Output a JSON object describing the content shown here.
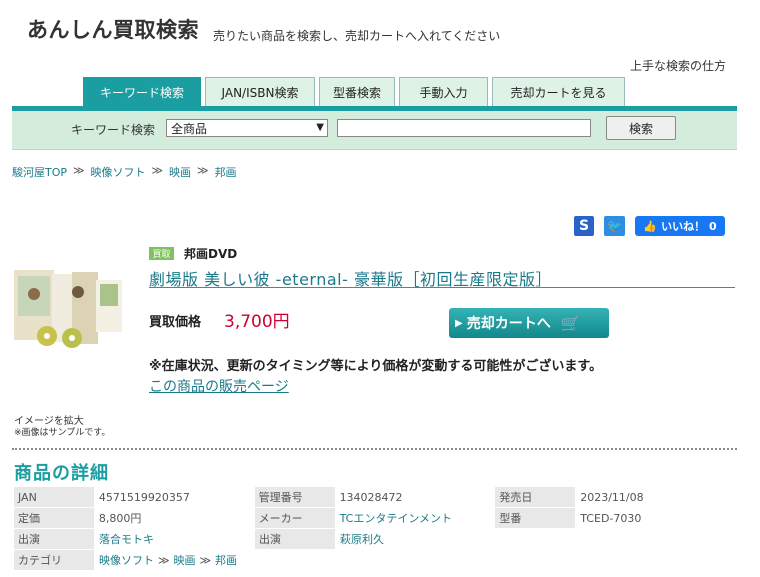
{
  "header": {
    "title": "あんしん買取検索",
    "subtitle": "売りたい商品を検索し、売却カートへ入れてください",
    "howto_link": "上手な検索の仕方"
  },
  "tabs": [
    {
      "label": "キーワード検索",
      "active": true
    },
    {
      "label": "JAN/ISBN検索",
      "active": false
    },
    {
      "label": "型番検索",
      "active": false
    },
    {
      "label": "手動入力",
      "active": false
    },
    {
      "label": "売却カートを見る",
      "active": false
    }
  ],
  "search": {
    "label": "キーワード検索",
    "category_selected": "全商品",
    "keyword_value": "",
    "button": "検索"
  },
  "breadcrumb": [
    "駿河屋TOP",
    "映像ソフト",
    "映画",
    "邦画"
  ],
  "breadcrumb_sep": "≫",
  "social": {
    "s_label": "S",
    "twitter_label": "🐦",
    "like_label": "いいね！ 0"
  },
  "product": {
    "badge": "買取",
    "genre": "邦画DVD",
    "title": "劇場版 美しい彼 -eternal- 豪華版［初回生産限定版］",
    "price_label": "買取価格",
    "price": "3,700円",
    "cart_button": "売却カートへ",
    "notice": "※在庫状況、更新のタイミング等により価格が変動する可能性がございます。",
    "sale_link": "この商品の販売ページ",
    "image_enlarge": "イメージを拡大",
    "image_note": "※画像はサンプルです。"
  },
  "details": {
    "heading": "商品の詳細",
    "rows": [
      [
        {
          "label": "JAN",
          "value": "4571519920357"
        },
        {
          "label": "管理番号",
          "value": "134028472"
        },
        {
          "label": "発売日",
          "value": "2023/11/08"
        }
      ],
      [
        {
          "label": "定価",
          "value": "8,800円"
        },
        {
          "label": "メーカー",
          "value": "TCエンタテインメント"
        },
        {
          "label": "型番",
          "value": "TCED-7030"
        }
      ],
      [
        {
          "label": "出演",
          "value": "落合モトキ"
        },
        {
          "label": "出演",
          "value": "萩原利久"
        },
        {
          "label": "",
          "value": ""
        }
      ]
    ],
    "category_label": "カテゴリ",
    "category_path": [
      "映像ソフト",
      "映画",
      "邦画"
    ]
  },
  "colors": {
    "accent": "#1a9ea1",
    "price": "#cc0033",
    "link": "#1a7a8a",
    "searchbar_bg": "#d4ecdc",
    "facebook": "#1877f2"
  }
}
